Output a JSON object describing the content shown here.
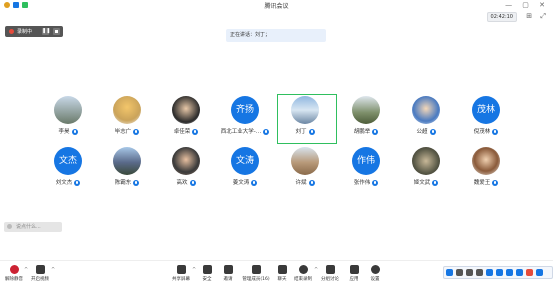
{
  "window": {
    "title": "腾讯会议",
    "timer": "02:42:10"
  },
  "record": {
    "label": "录制中"
  },
  "speaking": {
    "text": "正在讲话：刘丁；"
  },
  "participants": [
    {
      "name": "李昊",
      "avatar": "photo"
    },
    {
      "name": "毕志广",
      "avatar": "photo"
    },
    {
      "name": "卓佳荣",
      "avatar": "photo"
    },
    {
      "name": "西北工业大学-…",
      "avatar": "text",
      "avatar_text": "齐扬"
    },
    {
      "name": "刘丁",
      "avatar": "photo"
    },
    {
      "name": "胡鹏举",
      "avatar": "photo"
    },
    {
      "name": "公超",
      "avatar": "photo"
    },
    {
      "name": "倪茂林",
      "avatar": "text",
      "avatar_text": "茂林"
    },
    {
      "name": "刘文杰",
      "avatar": "text",
      "avatar_text": "文杰"
    },
    {
      "name": "陈霸东",
      "avatar": "photo"
    },
    {
      "name": "高欢",
      "avatar": "photo"
    },
    {
      "name": "姜文涛",
      "avatar": "text",
      "avatar_text": "文涛"
    },
    {
      "name": "许斌",
      "avatar": "photo"
    },
    {
      "name": "张作伟",
      "avatar": "text",
      "avatar_text": "作伟"
    },
    {
      "name": "姬文武",
      "avatar": "photo"
    },
    {
      "name": "魏爱王",
      "avatar": "photo"
    }
  ],
  "chat": {
    "placeholder": "说点什么..."
  },
  "toolbar": {
    "left": [
      {
        "label": "解除静音",
        "icon": "mic-muted-icon"
      },
      {
        "label": "开启视频",
        "icon": "camera-off-icon"
      }
    ],
    "center": [
      {
        "label": "共享屏幕",
        "icon": "screen-share-icon"
      },
      {
        "label": "安全",
        "icon": "shield-icon"
      },
      {
        "label": "邀请",
        "icon": "invite-icon"
      },
      {
        "label": "管理成员(16)",
        "icon": "members-icon"
      },
      {
        "label": "聊天",
        "icon": "chat-icon"
      },
      {
        "label": "结束录制",
        "icon": "record-stop-icon"
      },
      {
        "label": "分组讨论",
        "icon": "breakout-icon"
      },
      {
        "label": "应用",
        "icon": "apps-icon"
      },
      {
        "label": "设置",
        "icon": "settings-icon"
      }
    ]
  },
  "colors": {
    "accent": "#1676e3",
    "selected_border": "#2fbf5e",
    "record_dot": "#e54b3c"
  }
}
